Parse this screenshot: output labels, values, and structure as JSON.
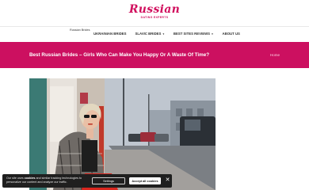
{
  "header": {
    "logo_main": "Russian",
    "logo_sub": "dating experts",
    "breadcrumb": "Russian Brides"
  },
  "nav": {
    "items": [
      {
        "label": "UKRAINIAN BRIDES",
        "has_dropdown": false
      },
      {
        "label": "SLAVIC BRIDES",
        "has_dropdown": true
      },
      {
        "label": "BEST SITES REVIEWS",
        "has_dropdown": true
      },
      {
        "label": "ABOUT US",
        "has_dropdown": false
      }
    ]
  },
  "hero": {
    "title": "Best Russian Brides – Girls Who Can Make You Happy Or A Waste Of Time?",
    "crumb": "Home",
    "color": "#cc1060"
  },
  "cookie": {
    "text_pre": "Our site uses ",
    "text_bold": "cookies",
    "text_post": " and similar tracking technologies to personalize our content and analyze our traffic.",
    "settings_label": "Settings",
    "accept_label": "Accept all cookies",
    "close_glyph": "✕"
  },
  "colors": {
    "accent": "#d1105e",
    "cookie_bg": "#1f1f1f"
  }
}
